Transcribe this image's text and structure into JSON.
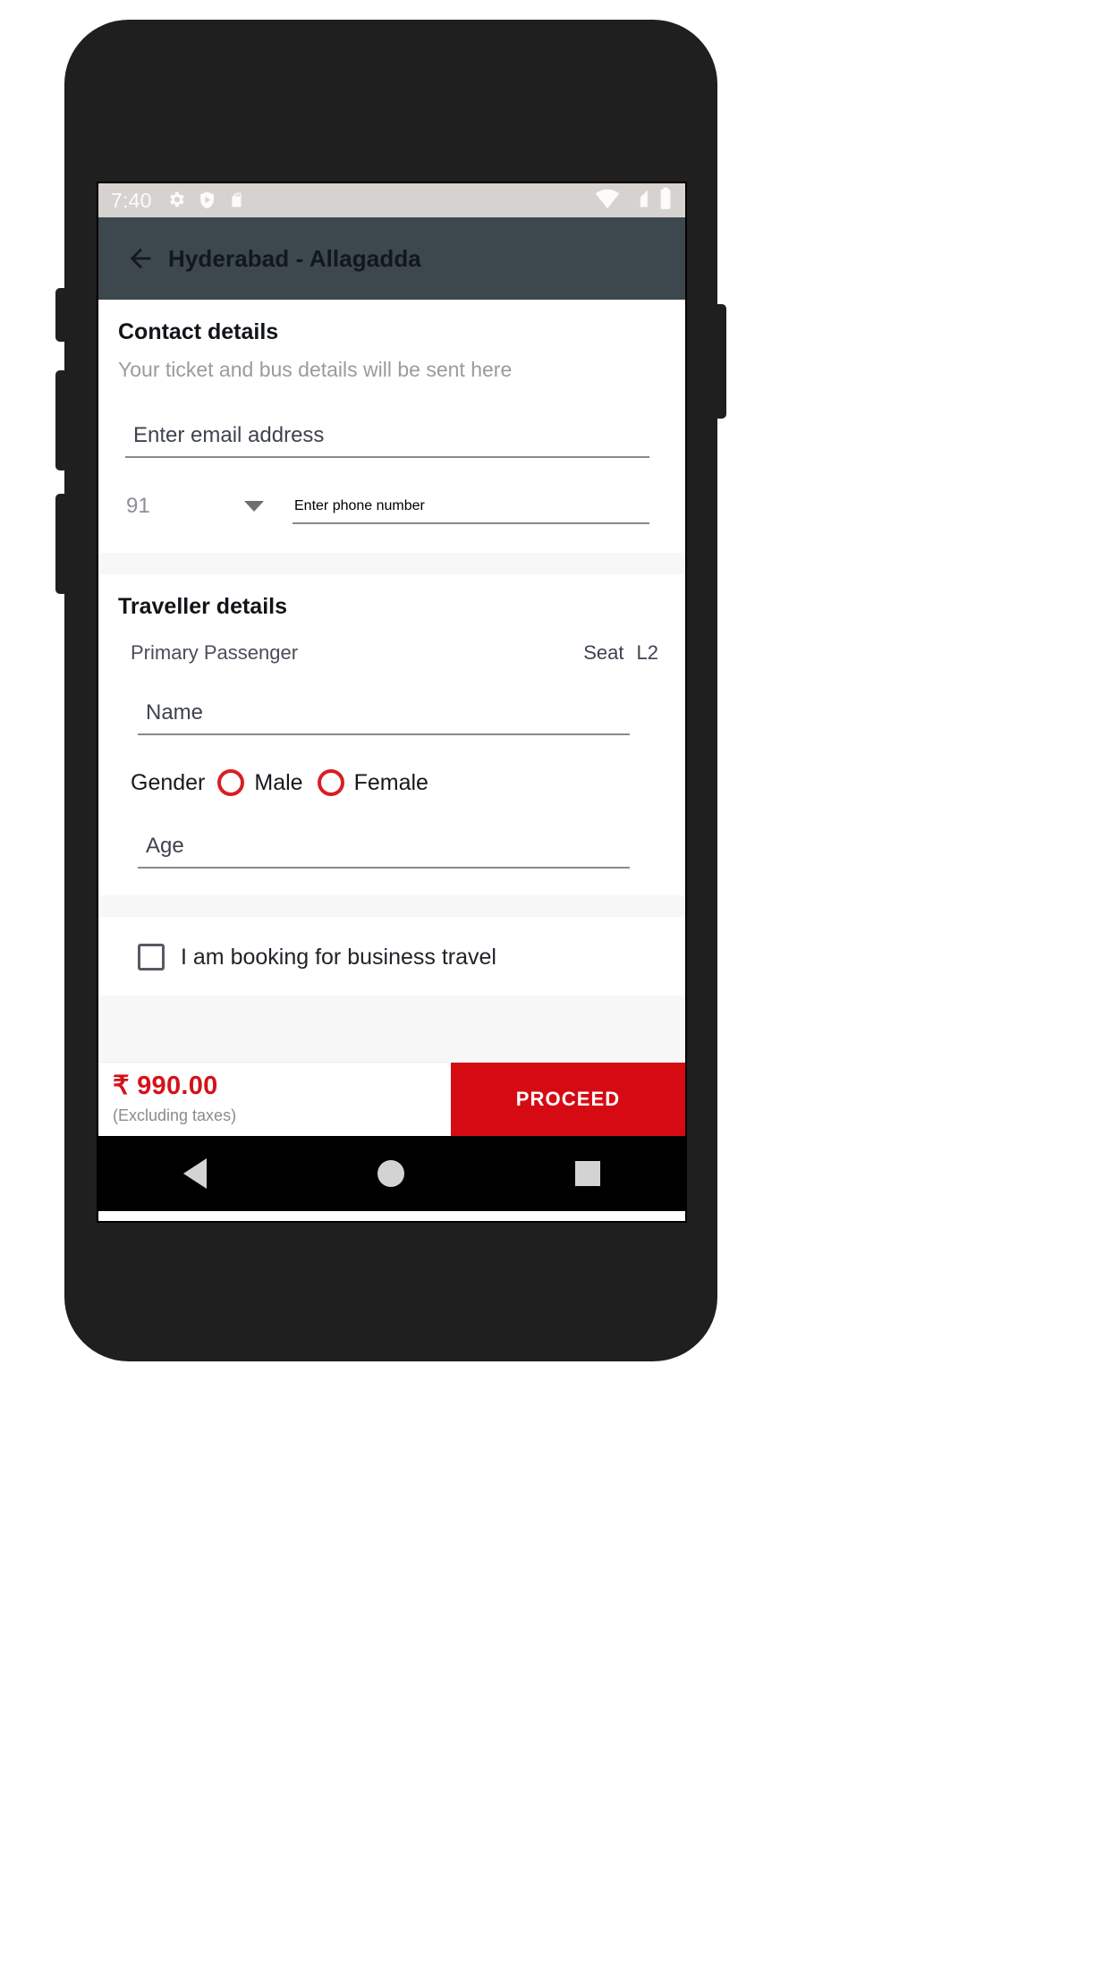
{
  "status_bar": {
    "time": "7:40",
    "left_icons": [
      "gear-icon",
      "play-shield-icon",
      "sd-card-icon"
    ],
    "right_icons": [
      "wifi-icon",
      "cellular-signal-icon",
      "battery-icon"
    ],
    "background": "#d6d2cf"
  },
  "app_bar": {
    "back_label": "back-arrow",
    "title": "Hyderabad - Allagadda",
    "background": "#3d474e"
  },
  "contact": {
    "title": "Contact details",
    "subtitle": "Your ticket and bus details will be sent here",
    "email": {
      "value": "",
      "placeholder": "Enter email address"
    },
    "country_code": {
      "value": "91",
      "caret": "chevron-down-icon"
    },
    "phone": {
      "value": "",
      "placeholder": "Enter phone number"
    }
  },
  "traveller": {
    "title": "Traveller details",
    "passenger_label": "Primary Passenger",
    "seat_label": "Seat",
    "seat_value": "L2",
    "name": {
      "value": "",
      "placeholder": "Name"
    },
    "gender": {
      "label": "Gender",
      "options": [
        "Male",
        "Female"
      ],
      "selected": "",
      "accent": "#d81f26"
    },
    "age": {
      "value": "",
      "placeholder": "Age"
    }
  },
  "business": {
    "label": "I am booking for business travel",
    "checked": false
  },
  "bottom_bar": {
    "price": "₹ 990.00",
    "price_note": "(Excluding taxes)",
    "price_color": "#d4121a",
    "proceed_label": "PROCEED",
    "proceed_color": "#d60a13"
  },
  "nav_bar": {
    "back": "nav-back-icon",
    "home": "nav-home-icon",
    "recents": "nav-recents-icon"
  }
}
